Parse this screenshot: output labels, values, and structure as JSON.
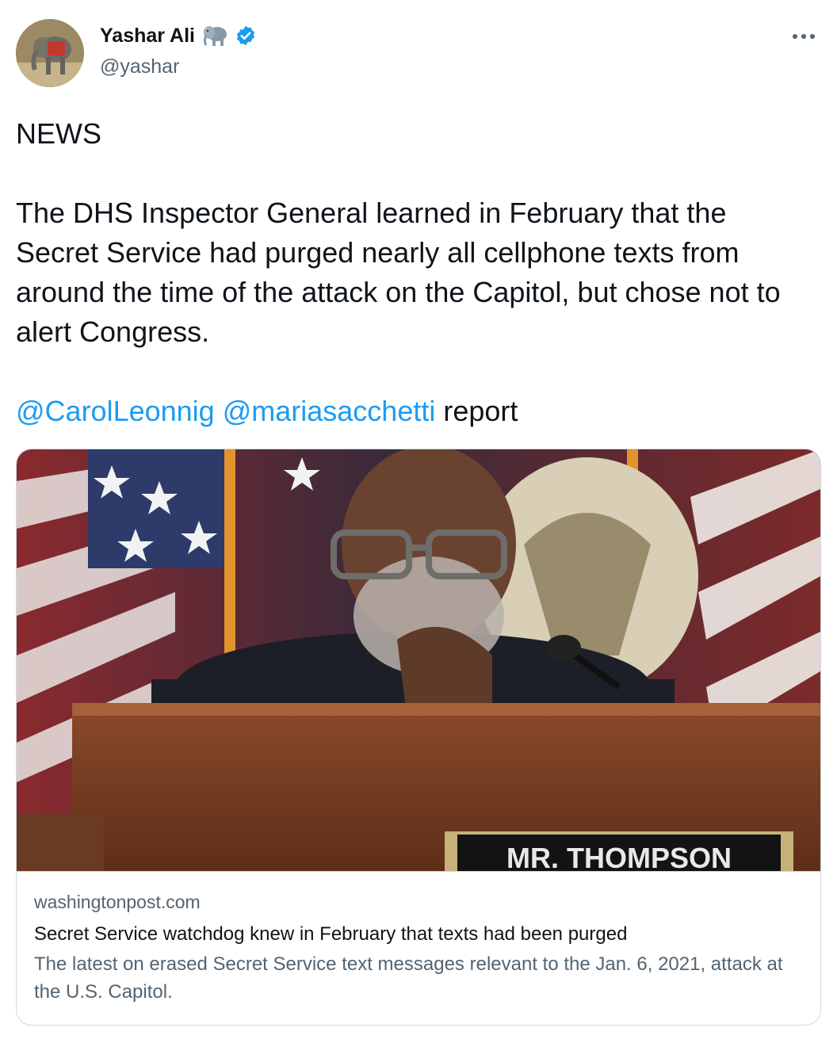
{
  "author": {
    "display_name": "Yashar Ali",
    "handle": "@yashar",
    "emoji_icon": "elephant-icon",
    "verified_icon": "verified-badge-icon",
    "avatar_icon": "baby-elephant-avatar"
  },
  "tweet": {
    "line1": "NEWS",
    "body": "The DHS Inspector General learned in February that the Secret Service had purged nearly all cellphone texts from around the time of the attack on the Capitol, but chose not to alert Congress.",
    "mention1": "@CarolLeonnig",
    "mention2": "@mariasacchetti",
    "suffix": "report"
  },
  "card": {
    "image_sign_text": "MR. THOMPSON",
    "domain": "washingtonpost.com",
    "title": "Secret Service watchdog knew in February that texts had been purged",
    "description": "The latest on erased Secret Service text messages relevant to the Jan. 6, 2021, attack at the U.S. Capitol."
  },
  "colors": {
    "link": "#1d9bf0",
    "secondary_text": "#536471",
    "primary_text": "#0f1419",
    "border": "#cfd9de"
  }
}
